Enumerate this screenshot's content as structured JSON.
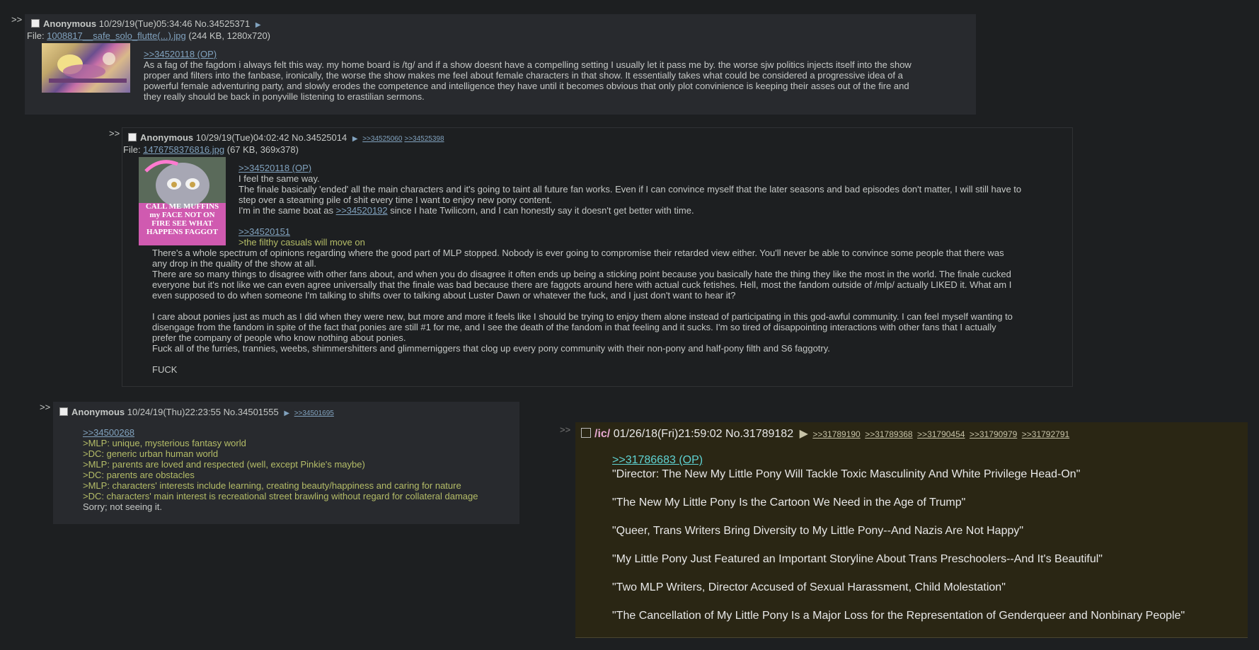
{
  "posts": [
    {
      "side": ">>",
      "name": "Anonymous",
      "datetime": "10/29/19(Tue)05:34:46",
      "no": "No.34525371",
      "arrow": "▶",
      "file_label": "File: ",
      "file_name": "1008817__safe_solo_flutte(...).jpg",
      "file_meta": " (244 KB, 1280x720)",
      "quote": ">>34520118 (OP)",
      "lines": [
        "As a fag of the fagdom i always felt this way. my home board is /tg/ and if a show doesnt have a compelling setting I usually let it pass me by. the worse sjw politics injects itself into the show",
        "proper and filters into the fanbase, ironically, the worse the show makes me feel about female characters in that show. It essentially takes what could be considered a progressive idea of a",
        "powerful female adventuring party, and slowly erodes the competence and intelligence they have until it becomes obvious that only plot convinience is keeping their asses out of the fire and",
        "they really should be back in ponyville listening to erastilian sermons."
      ]
    },
    {
      "side": ">>",
      "name": "Anonymous",
      "datetime": "10/29/19(Tue)04:02:42",
      "no": "No.34525014",
      "arrow": "▶",
      "backlinks": [
        ">>34525060",
        ">>34525398"
      ],
      "file_label": "File: ",
      "file_name": "1476758376816.jpg",
      "file_meta": " (67 KB, 369x378)",
      "thumb_text": "CALL ME MUFFINS my FACE NOT ON FIRE SEE WHAT HAPPENS FAGGOT",
      "quote": ">>34520118 (OP)",
      "l1": "I feel the same way.",
      "l2": "The finale basically 'ended' all the main characters and it's going to taint all future fan works. Even if I can convince myself that the later seasons and bad episodes don't matter, I will still have to",
      "l3": "step over a steaming pile of shit every time I want to enjoy new pony content.",
      "l4a": "I'm in the same boat as ",
      "l4link": ">>34520192",
      "l4b": " since I hate Twilicorn, and I can honestly say it doesn't get better with time.",
      "quote2": ">>34520151",
      "green1": ">the filthy casuals will move on",
      "body": [
        "There's a whole spectrum of opinions regarding where the good part of MLP stopped. Nobody is ever going to compromise their retarded view either. You'll never be able to convince some people that there was",
        "any drop in the quality of the show at all.",
        "There are so many things to disagree with other fans about, and when you do disagree it often ends up being a sticking point because you basically hate the thing they like the most in the world. The finale cucked",
        "everyone but it's not like we can even agree universally that the finale was bad because there are faggots around here with actual cuck fetishes. Hell, most the fandom outside of /mlp/ actually LIKED it. What am I",
        "even supposed to do when someone I'm talking to shifts over to talking about Luster Dawn or whatever the fuck, and I just don't want to hear it?",
        "",
        "I care about ponies just as much as I did when they were new, but more and more it feels like I should be trying to enjoy them alone instead of participating in this god-awful community. I can feel myself wanting to",
        "disengage from the fandom in spite of the fact that ponies are still #1 for me, and I see the death of the fandom in that feeling and it sucks. I'm so tired of disappointing interactions with other fans that I actually",
        "prefer the company of people who know nothing about ponies.",
        "Fuck all of the furries, trannies, weebs, shimmershitters and glimmerniggers that clog up every pony community with their non-pony and half-pony filth and S6 faggotry.",
        "",
        "FUCK"
      ]
    },
    {
      "side": ">>",
      "name": "Anonymous",
      "datetime": "10/24/19(Thu)22:23:55",
      "no": "No.34501555",
      "arrow": "▶",
      "backlinks": [
        ">>34501695"
      ],
      "quote": ">>34500268",
      "green": [
        ">MLP: unique, mysterious fantasy world",
        ">DC: generic urban human world",
        ">MLP: parents are loved and respected (well, except Pinkie's maybe)",
        ">DC: parents are obstacles",
        ">MLP: characters' interests include learning, creating beauty/happiness and caring for nature",
        ">DC: characters' main interest is recreational street brawling without regard for collateral damage"
      ],
      "end": "Sorry; not seeing it."
    }
  ],
  "ic_post": {
    "side": ">>",
    "board": "/ic/",
    "datetime": "01/26/18(Fri)21:59:02",
    "no": "No.31789182",
    "arrow": "▶",
    "backlinks": [
      ">>31789190",
      ">>31789368",
      ">>31790454",
      ">>31790979",
      ">>31792791"
    ],
    "quote": ">>31786683 (OP)",
    "headlines": [
      "\"Director: The New My Little Pony Will Tackle Toxic Masculinity And White Privilege Head-On\"",
      "\"The New My Little Pony Is the Cartoon We Need in the Age of Trump\"",
      "\"Queer, Trans Writers Bring Diversity to My Little Pony--And Nazis Are Not Happy\"",
      "\"My Little Pony Just Featured an Important Storyline About Trans Preschoolers--And It's Beautiful\"",
      "\"Two MLP Writers, Director Accused of Sexual Harassment, Child Molestation\"",
      "\"The Cancellation of My Little Pony Is a Major Loss for the Representation of Genderqueer and Nonbinary People\""
    ]
  },
  "colors": {
    "background": "#1d1f21",
    "post_bg": "#282a2e",
    "link": "#81a2be",
    "greentext": "#b5bd68",
    "ic_bg": "#2a2614"
  }
}
